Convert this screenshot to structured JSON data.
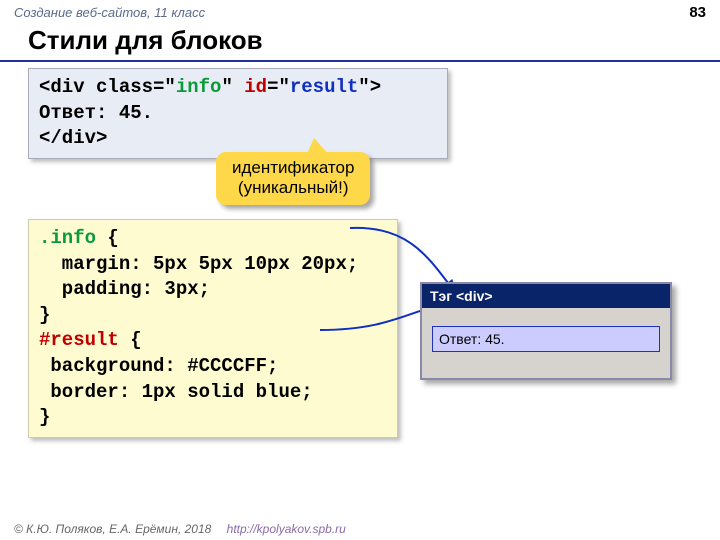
{
  "header": {
    "course": "Создание веб-сайтов, 11 класс",
    "page": "83"
  },
  "title": "Стили для блоков",
  "codebox1": {
    "line1_pre": "<div class=\"",
    "line1_cls": "info",
    "line1_mid": "\" ",
    "line1_idkw": "id",
    "line1_eq": "=\"",
    "line1_val": "result",
    "line1_post": "\">",
    "line2": "Ответ: 45.",
    "line3": "</div>"
  },
  "callout": {
    "line1": "идентификатор",
    "line2": "(уникальный!)"
  },
  "codebox2": {
    "l1_sel": ".info",
    "l1_rest": " {",
    "l2": "  margin: 5px 5px 10px 20px;",
    "l3": "  padding: 3px;",
    "l4": "}",
    "l5_sel": "#result",
    "l5_rest": " {",
    "l6": " background: #CCCCFF;",
    "l7": " border: 1px solid blue;",
    "l8": "}"
  },
  "window": {
    "title": "Тэг <div>",
    "result": "Ответ: 45."
  },
  "footer": {
    "copy": "© К.Ю. Поляков, Е.А. Ерёмин, 2018",
    "url": "http://kpolyakov.spb.ru"
  }
}
